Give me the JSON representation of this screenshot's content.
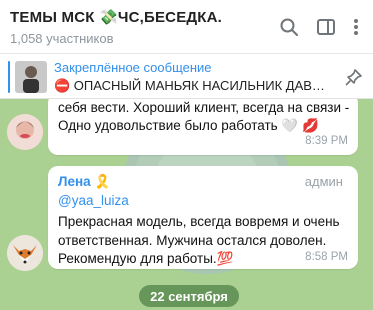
{
  "header": {
    "title": "ТЕМЫ МСК 💸ЧС,БЕСЕДКА.",
    "subtitle": "1,058 участников",
    "icons": [
      "search-icon",
      "columns-icon",
      "more-icon"
    ]
  },
  "pinned": {
    "label": "Закреплённое сообщение",
    "text": "⛔ ОПАСНЫЙ МАНЬЯК НАСИЛЬНИК ДАВ…",
    "accent": "#3390ec"
  },
  "messages": [
    {
      "text": "себя вести. Хороший клиент, всегда на связи - Одно удовольствие было работать 🤍 💋",
      "time": "8:39 PM"
    },
    {
      "sender": "Лена 🎗️",
      "role": "админ",
      "handle": "@yaa_luiza",
      "text": "Прекрасная модель, всегда вовремя и очень ответственная. Мужчина остался доволен. Рекомендую для работы.💯",
      "time": "8:58 PM"
    }
  ],
  "date_divider": "22 сентября",
  "colors": {
    "chat_background": "#aad191",
    "link": "#3390ec",
    "time": "#9aa3a9"
  }
}
